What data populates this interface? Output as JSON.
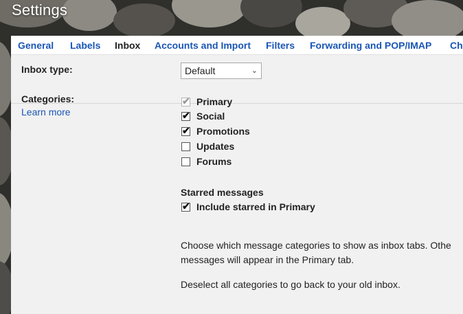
{
  "window": {
    "title": "Settings"
  },
  "tabs": [
    {
      "label": "General"
    },
    {
      "label": "Labels"
    },
    {
      "label": "Inbox"
    },
    {
      "label": "Accounts and Import"
    },
    {
      "label": "Filters"
    },
    {
      "label": "Forwarding and POP/IMAP"
    },
    {
      "label": "Ch"
    }
  ],
  "active_tab": "Inbox",
  "inbox_type": {
    "label": "Inbox type:",
    "selected": "Default"
  },
  "categories": {
    "label": "Categories:",
    "learn_more": "Learn more",
    "items": [
      {
        "label": "Primary",
        "checked": true,
        "disabled": true
      },
      {
        "label": "Social",
        "checked": true,
        "disabled": false
      },
      {
        "label": "Promotions",
        "checked": true,
        "disabled": false
      },
      {
        "label": "Updates",
        "checked": false,
        "disabled": false
      },
      {
        "label": "Forums",
        "checked": false,
        "disabled": false
      }
    ]
  },
  "starred": {
    "heading": "Starred messages",
    "option": {
      "label": "Include starred in Primary",
      "checked": true
    }
  },
  "help": {
    "line1": "Choose which message categories to show as inbox tabs. Othe",
    "line2": "messages will appear in the Primary tab.",
    "line3": "Deselect all categories to go back to your old inbox."
  },
  "icons": {
    "checkmark": "✔",
    "chevron": "⌄"
  },
  "colors": {
    "link": "#1a56b5",
    "panel": "#f1f1f1"
  }
}
